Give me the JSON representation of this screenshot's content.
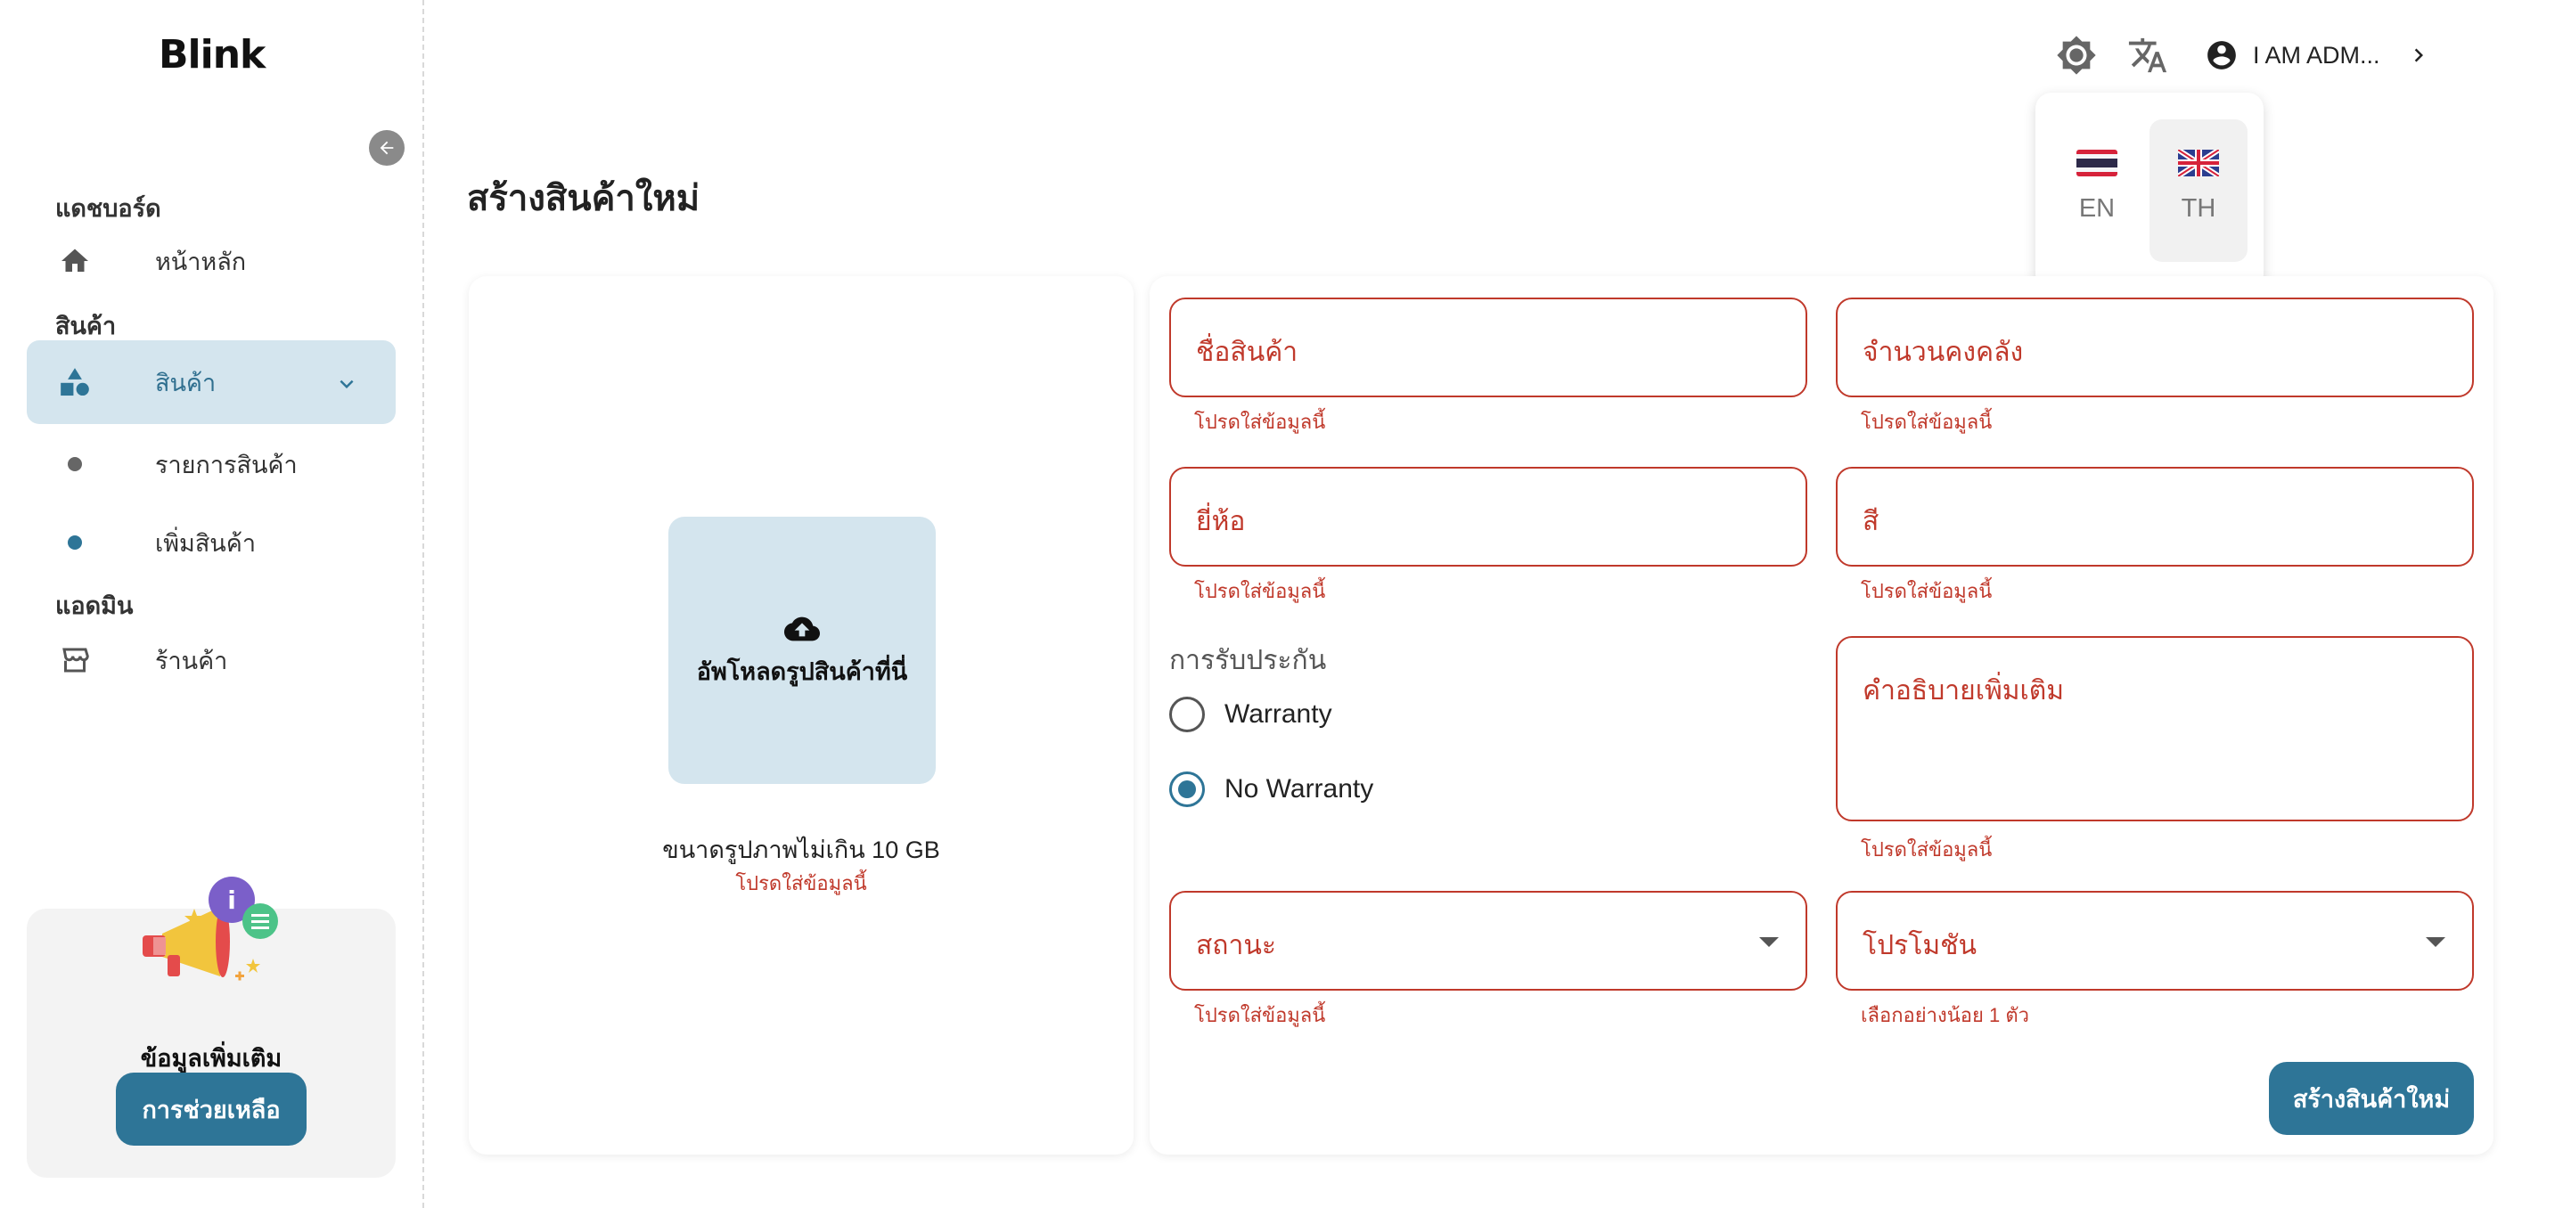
{
  "app": {
    "logo": "Blink"
  },
  "sidebar": {
    "section_dashboard": "แดชบอร์ด",
    "home": "หน้าหลัก",
    "section_products": "สินค้า",
    "products": "สินค้า",
    "product_list": "รายการสินค้า",
    "add_product": "เพิ่มสินค้า",
    "section_admin": "แอดมิน",
    "shop": "ร้านค้า"
  },
  "help": {
    "title": "ข้อมูลเพิ่มเติม",
    "button": "การช่วยเหลือ"
  },
  "topbar": {
    "user_name": "I AM ADM..."
  },
  "language": {
    "options": [
      {
        "code": "EN"
      },
      {
        "code": "TH"
      }
    ]
  },
  "page": {
    "title": "สร้างสินค้าใหม่"
  },
  "upload": {
    "button": "อัพโหลดรูปสินค้าที่นี่",
    "size_note": "ขนาดรูปภาพไม่เกิน 10 GB",
    "error": "โปรดใส่ข้อมูลนี้"
  },
  "form": {
    "name": {
      "placeholder": "ชื่อสินค้า",
      "error": "โปรดใส่ข้อมูลนี้"
    },
    "stock": {
      "placeholder": "จำนวนคงคลัง",
      "error": "โปรดใส่ข้อมูลนี้"
    },
    "brand": {
      "placeholder": "ยี่ห้อ",
      "error": "โปรดใส่ข้อมูลนี้"
    },
    "color": {
      "placeholder": "สี",
      "error": "โปรดใส่ข้อมูลนี้"
    },
    "warranty": {
      "label": "การรับประกัน",
      "opt1": "Warranty",
      "opt2": "No Warranty",
      "selected": "No Warranty"
    },
    "description": {
      "placeholder": "คำอธิบายเพิ่มเติม",
      "error": "โปรดใส่ข้อมูลนี้"
    },
    "status": {
      "placeholder": "สถานะ",
      "error": "โปรดใส่ข้อมูลนี้"
    },
    "promotion": {
      "placeholder": "โปรโมชัน",
      "error": "เลือกอย่างน้อย 1 ตัว"
    },
    "submit": "สร้างสินค้าใหม่"
  },
  "colors": {
    "accent": "#2e7597",
    "accent_light": "#d4e5ee",
    "error": "#c0392b"
  }
}
